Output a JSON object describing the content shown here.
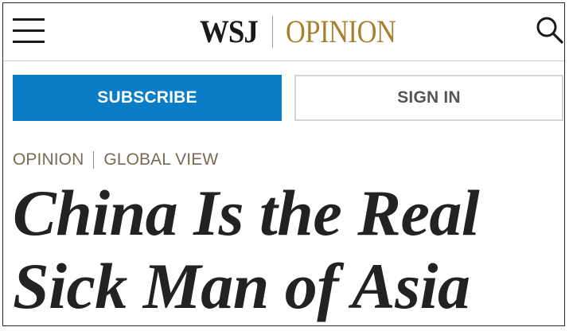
{
  "header": {
    "brand": "WSJ",
    "section_brand": "OPINION",
    "menu_icon": "hamburger-menu-icon",
    "search_icon": "search-icon",
    "brand_color": "#1a1a1a",
    "section_brand_color": "#a8802d"
  },
  "actions": {
    "subscribe_label": "SUBSCRIBE",
    "signin_label": "SIGN IN",
    "subscribe_color": "#0a7dc6"
  },
  "article": {
    "section": "OPINION",
    "column": "GLOBAL VIEW",
    "headline_line1": "China Is the Real",
    "headline_line2": "Sick Man of Asia"
  }
}
